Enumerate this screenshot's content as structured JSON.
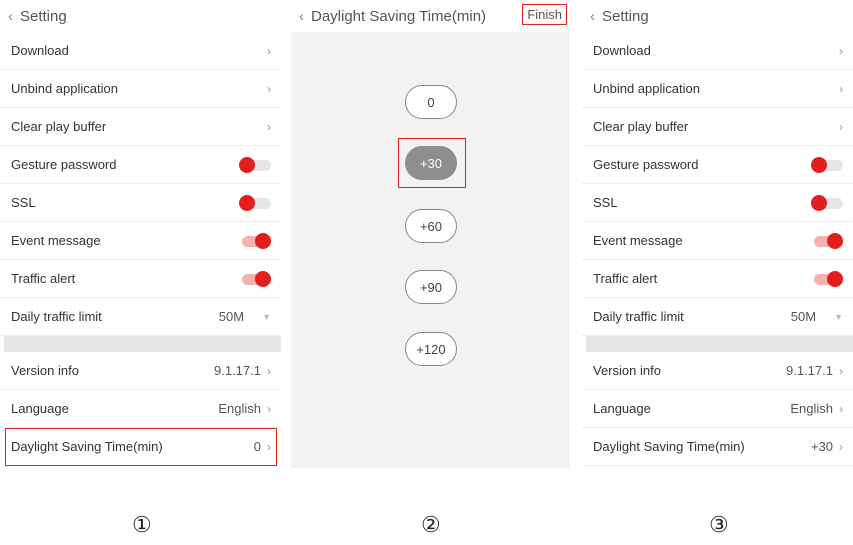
{
  "panels": [
    {
      "title": "Setting",
      "rows": [
        {
          "label": "Download"
        },
        {
          "label": "Unbind application"
        },
        {
          "label": "Clear play buffer"
        },
        {
          "label": "Gesture password"
        },
        {
          "label": "SSL"
        },
        {
          "label": "Event message"
        },
        {
          "label": "Traffic alert"
        },
        {
          "label": "Daily traffic limit",
          "value": "50M"
        }
      ],
      "rows2": [
        {
          "label": "Version info",
          "value": "9.1.17.1"
        },
        {
          "label": "Language",
          "value": "English"
        },
        {
          "label": "Daylight Saving Time(min)",
          "value": "0"
        }
      ]
    },
    {
      "title": "Setting",
      "rows": [
        {
          "label": "Download"
        },
        {
          "label": "Unbind application"
        },
        {
          "label": "Clear play buffer"
        },
        {
          "label": "Gesture password"
        },
        {
          "label": "SSL"
        },
        {
          "label": "Event message"
        },
        {
          "label": "Traffic alert"
        },
        {
          "label": "Daily traffic limit",
          "value": "50M"
        }
      ],
      "rows2": [
        {
          "label": "Version info",
          "value": "9.1.17.1"
        },
        {
          "label": "Language",
          "value": "English"
        },
        {
          "label": "Daylight Saving Time(min)",
          "value": "+30"
        }
      ]
    }
  ],
  "dst_picker": {
    "title": "Daylight Saving Time(min)",
    "finish_label": "Finish",
    "options": [
      "0",
      "+30",
      "+60",
      "+90",
      "+120"
    ],
    "selected": "+30"
  },
  "step_labels": [
    "①",
    "②",
    "③"
  ],
  "colors": {
    "accent": "#e21e1e",
    "highlight": "#e02020",
    "selected_option": "#8e8e8e"
  }
}
